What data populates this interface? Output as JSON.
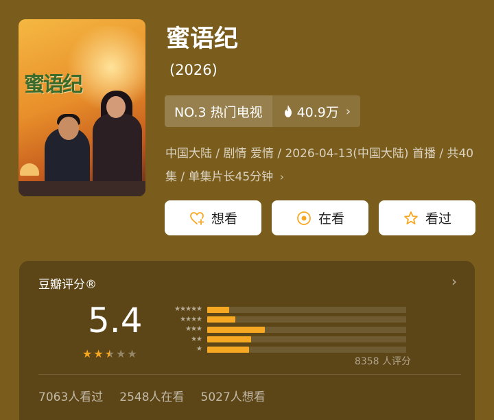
{
  "show": {
    "title": "蜜语纪",
    "year": "(2026)",
    "poster_title": "蜜语纪"
  },
  "rank": {
    "label": "NO.3 热门电视",
    "heat": "40.9万"
  },
  "meta": {
    "text": "中国大陆 / 剧情 爱情 / 2026-04-13(中国大陆) 首播 / 共40集 / 单集片长45分钟"
  },
  "actions": {
    "want": "想看",
    "watching": "在看",
    "watched": "看过"
  },
  "rating": {
    "header": "豆瓣评分®",
    "score": "5.4",
    "stars_value": 2.5,
    "stars_max": 5,
    "distribution": [
      {
        "stars": 5,
        "fraction": 0.11
      },
      {
        "stars": 4,
        "fraction": 0.14
      },
      {
        "stars": 3,
        "fraction": 0.29
      },
      {
        "stars": 2,
        "fraction": 0.22
      },
      {
        "stars": 1,
        "fraction": 0.21
      }
    ],
    "count_text": "8358 人评分"
  },
  "stats": {
    "watched": "7063人看过",
    "watching": "2548人在看",
    "want": "5027人想看"
  },
  "colors": {
    "background": "#7a5d1c",
    "card": "#5c4516",
    "accent": "#f7a823"
  }
}
